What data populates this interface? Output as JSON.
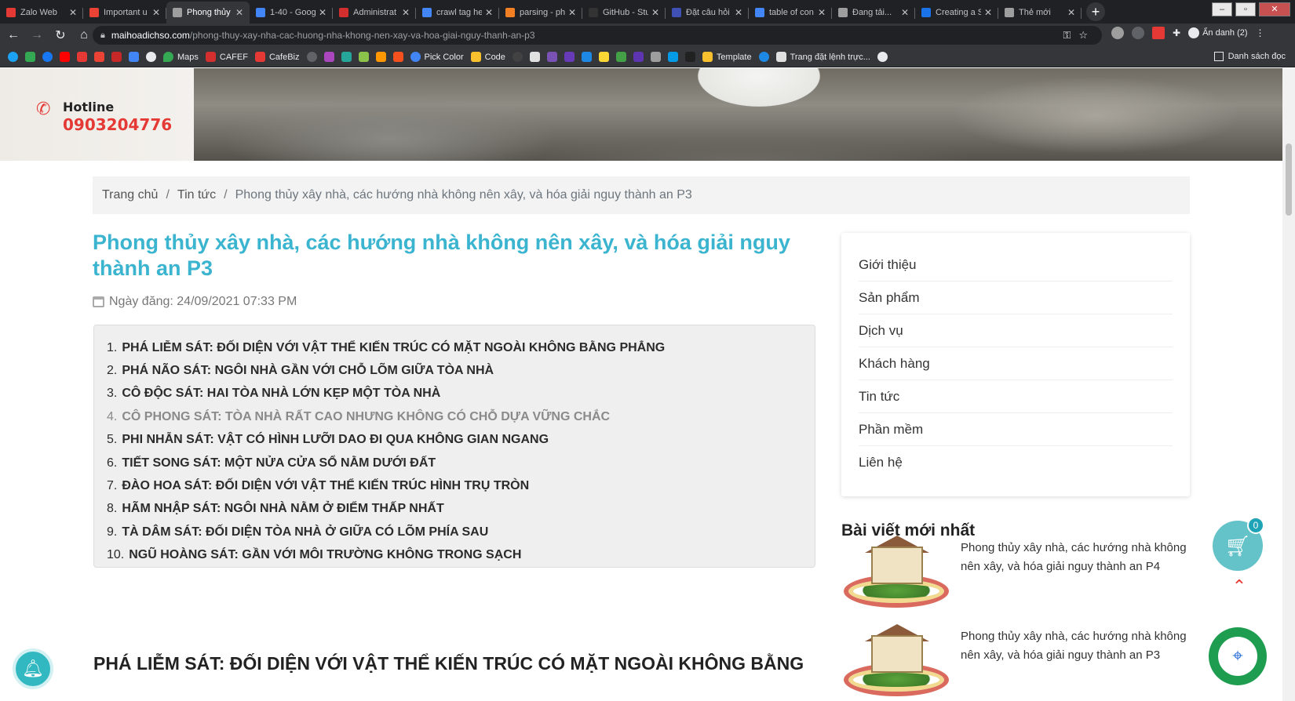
{
  "browser": {
    "tabs": [
      {
        "title": "Zalo Web",
        "color": "#e53935",
        "active": false
      },
      {
        "title": "Important u",
        "color": "#ea4335",
        "active": false
      },
      {
        "title": "Phong thủy",
        "color": "#9e9e9e",
        "active": true
      },
      {
        "title": "1-40 - Goog",
        "color": "#4285f4",
        "active": false
      },
      {
        "title": "Administrat",
        "color": "#d32f2f",
        "active": false
      },
      {
        "title": "crawl tag he",
        "color": "#4285f4",
        "active": false
      },
      {
        "title": "parsing - ph",
        "color": "#f48024",
        "active": false
      },
      {
        "title": "GitHub - Stu",
        "color": "#333333",
        "active": false
      },
      {
        "title": "Đặt câu hỏi",
        "color": "#3f51b5",
        "active": false
      },
      {
        "title": "table of con",
        "color": "#4285f4",
        "active": false
      },
      {
        "title": "Đang tải...",
        "color": "#9e9e9e",
        "active": false
      },
      {
        "title": "Creating a S",
        "color": "#1a73e8",
        "active": false
      },
      {
        "title": "Thẻ mới",
        "color": "#9e9e9e",
        "active": false
      }
    ],
    "url_host": "maihoadichso.com",
    "url_path": "/phong-thuy-xay-nha-cac-huong-nha-khong-nen-xay-va-hoa-giai-nguy-thanh-an-p3",
    "profile_label": "Ẩn danh (2)",
    "bookmarks": [
      {
        "label": "Maps",
        "color": "#34a853"
      },
      {
        "label": "CAFEF",
        "color": "#d32f2f"
      },
      {
        "label": "CafeBiz",
        "color": "#e53935"
      },
      {
        "label": "Pick Color",
        "color": "#4285f4"
      },
      {
        "label": "Code",
        "color": "#fbc02d"
      },
      {
        "label": "Template",
        "color": "#fbc02d"
      },
      {
        "label": "Trang đặt lệnh trực...",
        "color": "#e0e0e0"
      }
    ],
    "reading_list": "Danh sách đọc"
  },
  "hero": {
    "hotline_label": "Hotline",
    "hotline_number": "0903204776"
  },
  "breadcrumb": {
    "home": "Trang chủ",
    "category": "Tin tức",
    "current": "Phong thủy xây nhà, các hướng nhà không nên xây, và hóa giải nguy thành an P3"
  },
  "article": {
    "title": "Phong thủy xây nhà, các hướng nhà không nên xây, và hóa giải nguy thành an P3",
    "date": "Ngày đăng: 24/09/2021 07:33 PM",
    "toc": [
      {
        "n": "1.",
        "text": "PHÁ LIỄM SÁT: ĐỐI DIỆN VỚI VẬT THỂ KIẾN TRÚC CÓ MẶT NGOÀI KHÔNG BẰNG PHẲNG"
      },
      {
        "n": "2.",
        "text": "PHÁ NÃO SÁT: NGÔI NHÀ GẦN VỚI CHỖ LÕM GIỮA TÒA NHÀ"
      },
      {
        "n": "3.",
        "text": "CÔ ĐỘC SÁT: HAI TÒA NHÀ LỚN KẸP MỘT TÒA NHÀ"
      },
      {
        "n": "4.",
        "text": "CÔ PHONG SÁT: TÒA NHÀ RẤT CAO NHƯNG KHÔNG CÓ CHỖ DỰA VỮNG CHẮC"
      },
      {
        "n": "5.",
        "text": "PHI NHẪN SÁT: VẬT CÓ HÌNH LƯỠI DAO ĐI QUA KHÔNG GIAN NGANG"
      },
      {
        "n": "6.",
        "text": "TIẾT SONG SÁT: MỘT NỬA CỬA SỔ NẰM DƯỚI ĐẤT"
      },
      {
        "n": "7.",
        "text": "ĐÀO HOA SÁT: ĐỐI DIỆN VỚI VẬT THỂ KIẾN TRÚC HÌNH TRỤ TRÒN"
      },
      {
        "n": "8.",
        "text": "HÃM NHẬP SÁT: NGÔI NHÀ NẰM Ở ĐIỂM THẤP NHẤT"
      },
      {
        "n": "9.",
        "text": "TÀ DÂM SÁT: ĐỐI DIỆN TÒA NHÀ Ở GIỮA CÓ LÕM PHÍA SAU"
      },
      {
        "n": "10.",
        "text": "NGŨ HOÀNG SÁT: GẦN VỚI MÔI TRƯỜNG KHÔNG TRONG SẠCH"
      }
    ],
    "section_heading": "PHÁ LIỄM SÁT: ĐỐI DIỆN VỚI VẬT THỂ KIẾN TRÚC CÓ MẶT NGOÀI KHÔNG BẰNG"
  },
  "sidebar": {
    "menu": [
      "Giới thiệu",
      "Sản phẩm",
      "Dịch vụ",
      "Khách hàng",
      "Tin tức",
      "Phần mềm",
      "Liên hệ"
    ],
    "recent_title": "Bài viết mới nhất",
    "recent_posts": [
      "Phong thủy xây nhà, các hướng nhà không nên xây, và hóa giải nguy thành an P4",
      "Phong thủy xây nhà, các hướng nhà không nên xây, và hóa giải nguy thành an P3"
    ]
  },
  "widgets": {
    "cart_count": "0",
    "accent": "#3bb4d0"
  }
}
